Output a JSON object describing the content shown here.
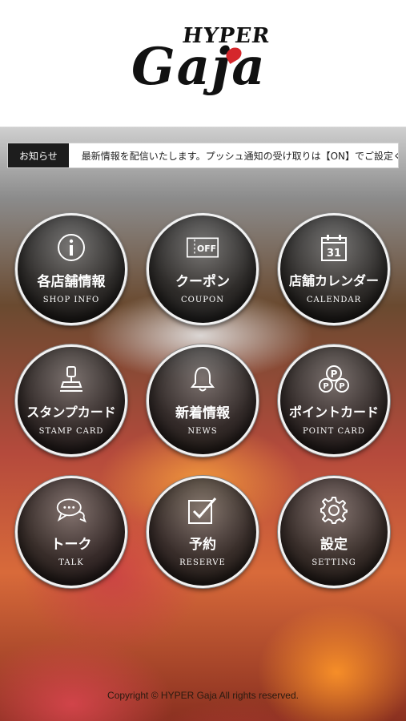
{
  "header": {
    "logo_top": "HYPER",
    "logo_main": "Gaja"
  },
  "news": {
    "tag": "お知らせ",
    "text": "最新情報を配信いたします。プッシュ通知の受け取りは【ON】でご設定ください。"
  },
  "menu": [
    {
      "jp": "各店舗情報",
      "en": "SHOP INFO",
      "icon": "info-icon"
    },
    {
      "jp": "クーポン",
      "en": "COUPON",
      "icon": "coupon-icon",
      "icon_text": "OFF"
    },
    {
      "jp": "店舗カレンダー",
      "en": "CALENDAR",
      "icon": "calendar-icon",
      "icon_text": "31"
    },
    {
      "jp": "スタンプカード",
      "en": "STAMP CARD",
      "icon": "stamp-icon"
    },
    {
      "jp": "新着情報",
      "en": "NEWS",
      "icon": "bell-icon"
    },
    {
      "jp": "ポイントカード",
      "en": "POINT CARD",
      "icon": "point-icon",
      "icon_text": "P"
    },
    {
      "jp": "トーク",
      "en": "TALK",
      "icon": "chat-icon"
    },
    {
      "jp": "予約",
      "en": "RESERVE",
      "icon": "checkbox-icon"
    },
    {
      "jp": "設定",
      "en": "SETTING",
      "icon": "gear-icon"
    }
  ],
  "footer": {
    "copyright": "Copyright © HYPER Gaja All rights reserved."
  },
  "colors": {
    "logo_red": "#d5272c",
    "button_dark": "#1d1d1d"
  }
}
